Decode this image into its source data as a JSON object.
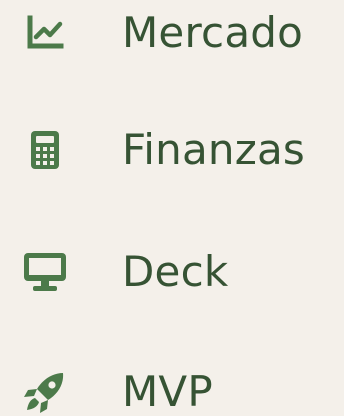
{
  "colors": {
    "background": "#f4f0ea",
    "accent": "#4c7a4a",
    "text": "#365334"
  },
  "nav": {
    "items": [
      {
        "label": "Mercado",
        "icon": "line-chart-icon"
      },
      {
        "label": "Finanzas",
        "icon": "calculator-icon"
      },
      {
        "label": "Deck",
        "icon": "monitor-icon"
      },
      {
        "label": "MVP",
        "icon": "rocket-icon"
      }
    ]
  }
}
